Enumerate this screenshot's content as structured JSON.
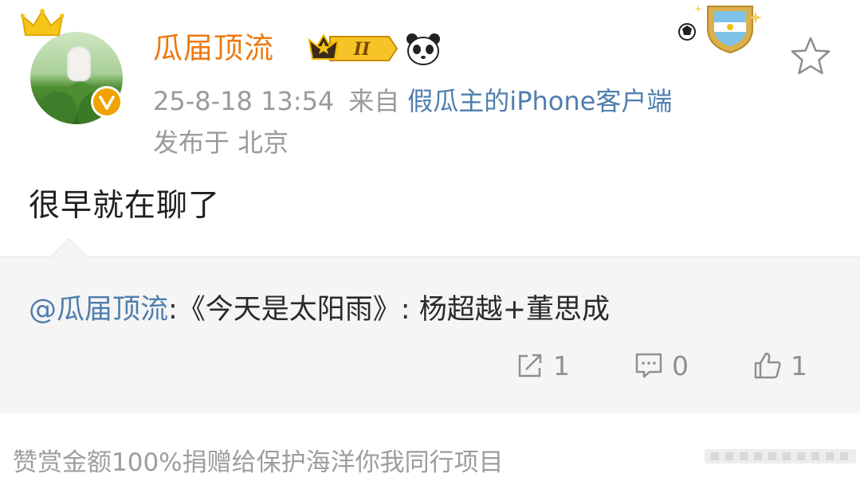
{
  "post": {
    "username": "瓜届顶流",
    "level_badge_text": "II",
    "timestamp": "25-8-18 13:54",
    "from_label": "来自",
    "client": "假瓜主的iPhone客户端",
    "location": "发布于 北京",
    "text": "很早就在聊了"
  },
  "retweet": {
    "mention": "@瓜届顶流",
    "content": ":《今天是太阳雨》: 杨超越+董思成",
    "actions": {
      "repost_count": "1",
      "comment_count": "0",
      "like_count": "1"
    }
  },
  "footer": {
    "text": "赞赏金额100%捐赠给保护海洋你我同行项目"
  },
  "colors": {
    "username": "#ec7a12",
    "link": "#4f7eae",
    "meta": "#9a9a9a",
    "retweet_bg": "#f5f5f5",
    "verified": "#f0a300"
  },
  "icons": [
    "crown-icon",
    "verified-icon",
    "level-badge-icon",
    "panda-icon",
    "argentina-badge-icon",
    "star-icon",
    "repost-icon",
    "comment-icon",
    "like-icon"
  ]
}
